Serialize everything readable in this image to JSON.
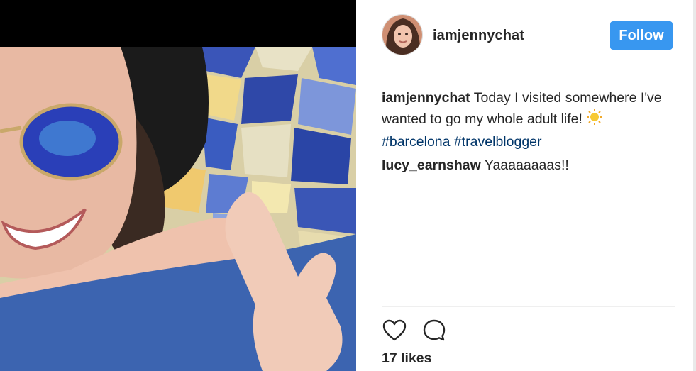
{
  "post": {
    "username": "iamjennychat",
    "follow_label": "Follow",
    "likes_text": "17 likes"
  },
  "comments": [
    {
      "user": "iamjennychat",
      "text": "Today I visited somewhere I've wanted to go my whole adult life!",
      "emoji": "sun-icon",
      "hashtags": [
        "#barcelona",
        "#travelblogger"
      ]
    },
    {
      "user": "lucy_earnshaw",
      "text": "Yaaaaaaaas!!"
    }
  ],
  "icons": [
    "heart-icon",
    "comment-icon",
    "sun-icon"
  ],
  "colors": {
    "follow_button": "#3897f0",
    "hashtag": "#003569",
    "text": "#262626",
    "divider": "#efefef"
  }
}
